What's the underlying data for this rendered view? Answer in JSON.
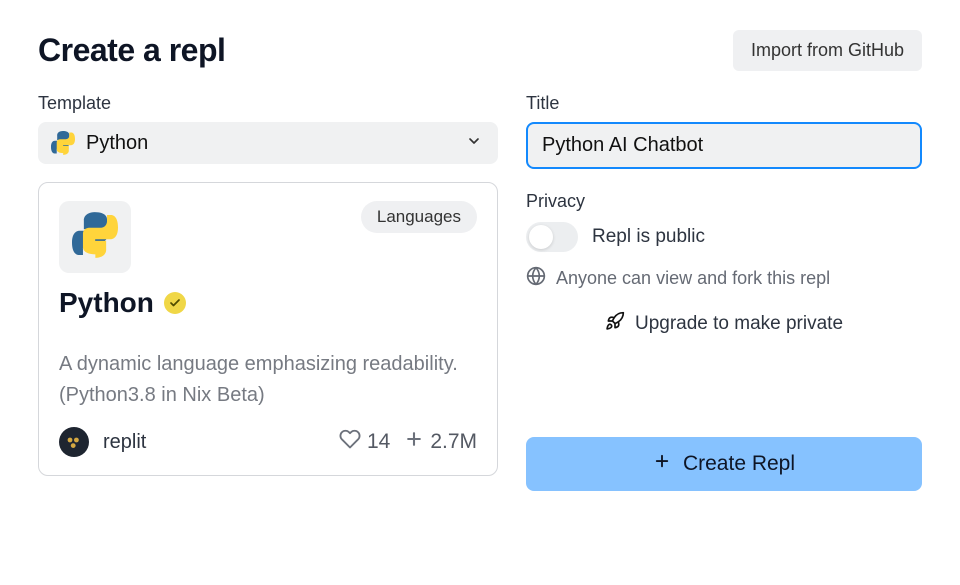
{
  "header": {
    "title": "Create a repl",
    "import_label": "Import from GitHub"
  },
  "template": {
    "field_label": "Template",
    "selected": "Python",
    "card": {
      "badge": "Languages",
      "name": "Python",
      "description": "A dynamic language emphasizing readability. (Python3.8 in Nix Beta)",
      "author": "replit",
      "likes": "14",
      "forks": "2.7M"
    }
  },
  "title_field": {
    "label": "Title",
    "value": "Python AI Chatbot"
  },
  "privacy": {
    "label": "Privacy",
    "toggle_label": "Repl is public",
    "hint": "Anyone can view and fork this repl",
    "upgrade_label": "Upgrade to make private"
  },
  "create_button": {
    "label": "Create Repl"
  }
}
